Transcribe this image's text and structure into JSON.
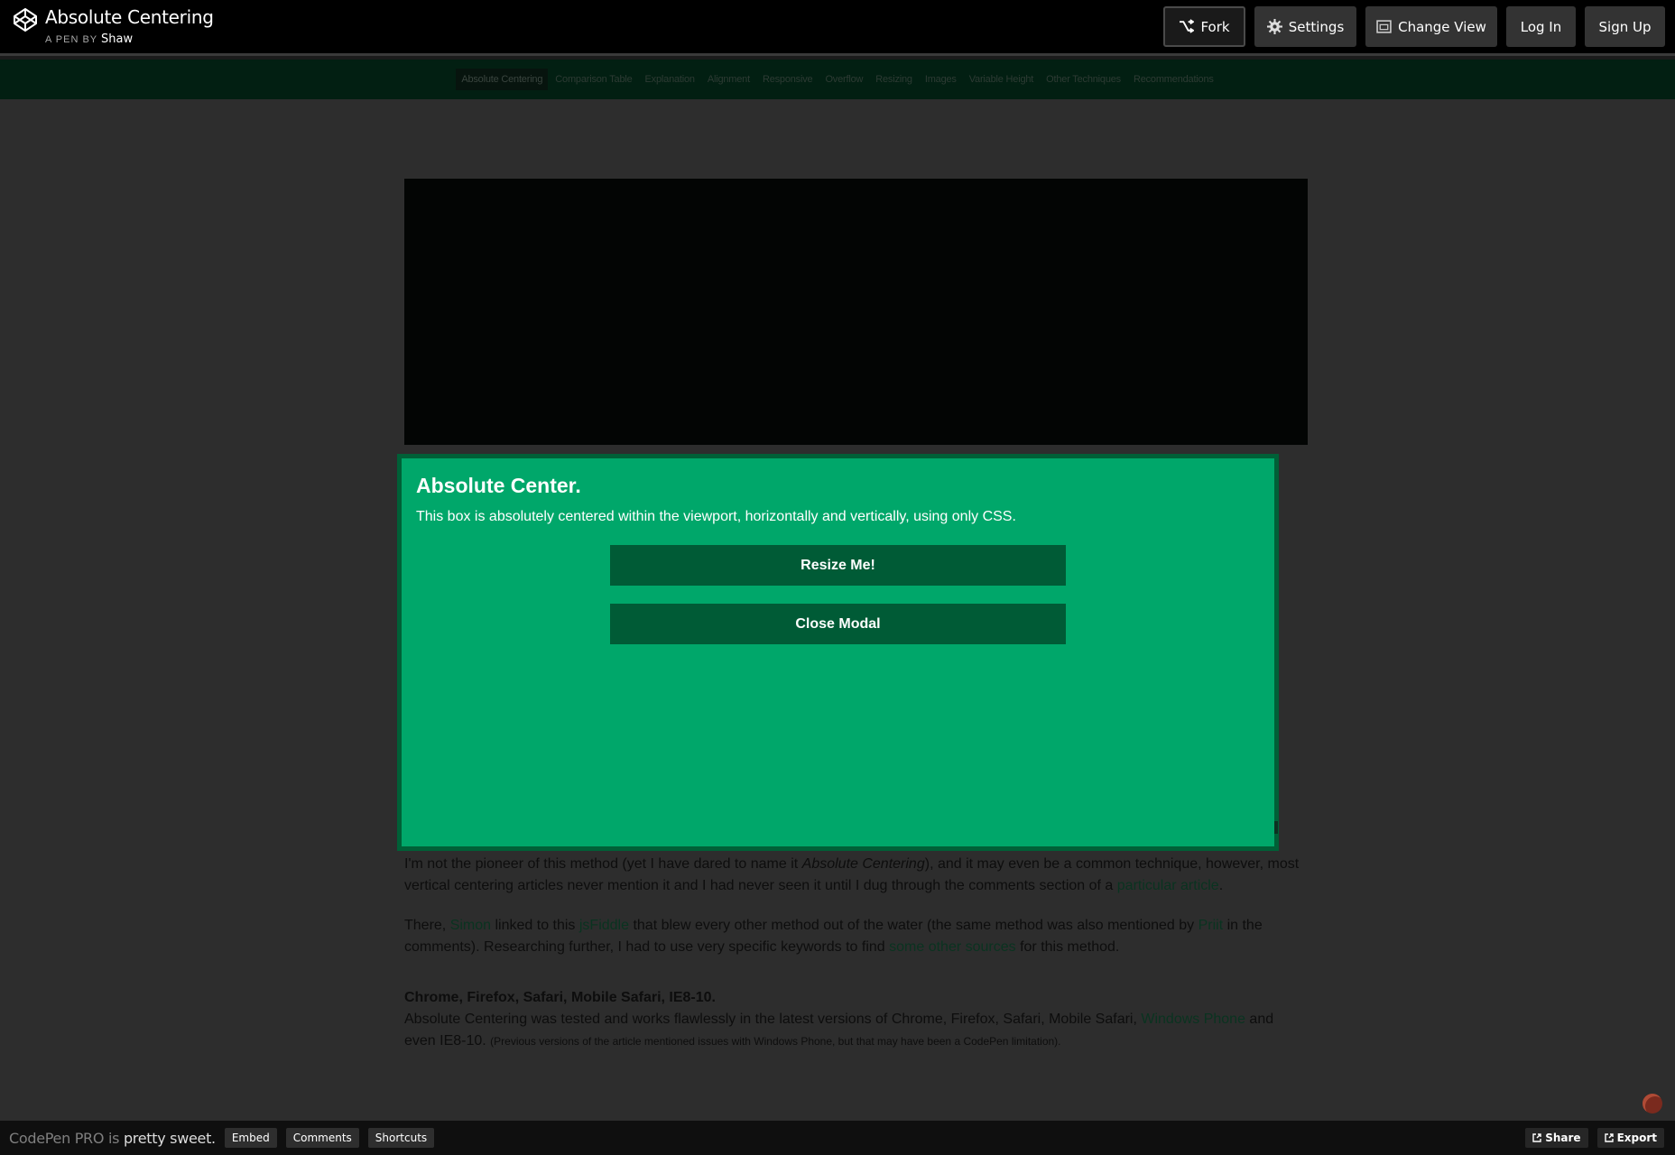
{
  "header": {
    "title": "Absolute Centering",
    "byline_prefix": "A PEN BY",
    "author": "Shaw",
    "buttons": {
      "fork": "Fork",
      "settings": "Settings",
      "change_view": "Change View",
      "login": "Log In",
      "signup": "Sign Up"
    }
  },
  "nav": {
    "items": [
      "Absolute Centering",
      "Comparison Table",
      "Explanation",
      "Alignment",
      "Responsive",
      "Overflow",
      "Resizing",
      "Images",
      "Variable Height",
      "Other Techniques",
      "Recommendations"
    ],
    "active_index": 0
  },
  "modal": {
    "title": "Absolute Center.",
    "text": "This box is absolutely centered within the viewport, horizontally and vertically, using only CSS.",
    "resize_button": "Resize Me!",
    "close_button": "Close Modal"
  },
  "article": {
    "p1_a": "I'm not the pioneer of this method (yet I have dared to name it ",
    "p1_em": "Absolute Centering",
    "p1_b": "), and it may even be a common technique, however, most vertical centering articles never mention it and I had never seen it until I dug through the comments section of a ",
    "p1_link": "particular article",
    "p1_c": ".",
    "p2_a": "There, ",
    "p2_link1": "Simon",
    "p2_b": " linked to this ",
    "p2_link2": "jsFiddle",
    "p2_c": " that blew every other method out of the water (the same method was also mentioned by ",
    "p2_link3": "Priit",
    "p2_d": " in the comments). Researching further, I had to use very specific keywords to find ",
    "p2_link4": "some other sources",
    "p2_e": " for this method.",
    "browsers_heading": "Chrome, Firefox, Safari, Mobile Safari, IE8-10.",
    "p3_a": "Absolute Centering was tested and works flawlessly in the latest versions of Chrome, Firefox, Safari, Mobile Safari, ",
    "p3_link": "Windows Phone",
    "p3_b": " and even IE8-10. ",
    "p3_small": "(Previous versions of the article mentioned issues with Windows Phone, but that may have been a CodePen limitation)."
  },
  "footer": {
    "promo_prefix": "CodePen PRO is ",
    "promo_bold": "pretty sweet.",
    "embed": "Embed",
    "comments": "Comments",
    "shortcuts": "Shortcuts",
    "share": "Share",
    "export": "Export"
  },
  "icons": {
    "logo": "codepen-logo-icon",
    "fork": "fork-icon",
    "settings": "gear-icon",
    "change_view": "window-icon",
    "share": "external-link-icon",
    "export": "external-link-icon"
  },
  "colors": {
    "modal_bg": "#00a76a",
    "modal_border": "#006037",
    "modal_button": "#005b36",
    "header_bg": "#000000",
    "page_bg": "#2d2d2d"
  }
}
